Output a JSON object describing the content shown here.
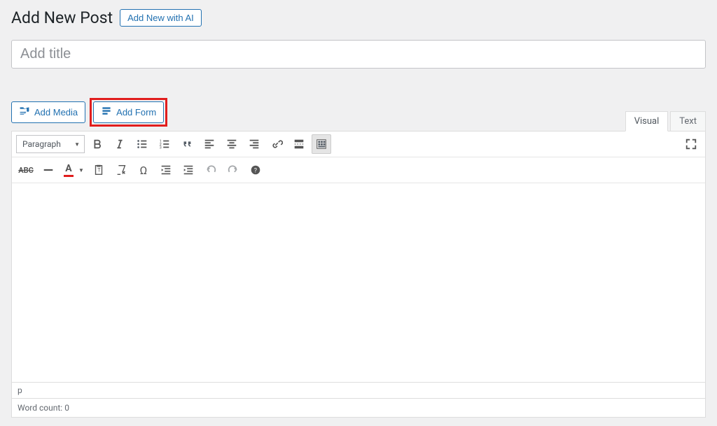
{
  "header": {
    "page_title": "Add New Post",
    "ai_button": "Add New with AI"
  },
  "title_field": {
    "placeholder": "Add title",
    "value": ""
  },
  "media_buttons": {
    "add_media": "Add Media",
    "add_form": "Add Form"
  },
  "tabs": {
    "visual": "Visual",
    "text": "Text",
    "active": "visual"
  },
  "format_dropdown": {
    "selected": "Paragraph"
  },
  "toolbar_row1": [
    {
      "name": "bold-icon"
    },
    {
      "name": "italic-icon"
    },
    {
      "name": "bullet-list-icon"
    },
    {
      "name": "numbered-list-icon"
    },
    {
      "name": "blockquote-icon"
    },
    {
      "name": "align-left-icon"
    },
    {
      "name": "align-center-icon"
    },
    {
      "name": "align-right-icon"
    },
    {
      "name": "link-icon"
    },
    {
      "name": "read-more-icon"
    },
    {
      "name": "toolbar-toggle-icon",
      "active": true
    }
  ],
  "toolbar_row2": [
    {
      "name": "strikethrough-icon"
    },
    {
      "name": "horizontal-rule-icon"
    },
    {
      "name": "text-color-icon"
    },
    {
      "name": "paste-text-icon"
    },
    {
      "name": "clear-formatting-icon"
    },
    {
      "name": "special-char-icon"
    },
    {
      "name": "outdent-icon"
    },
    {
      "name": "indent-icon"
    },
    {
      "name": "undo-icon",
      "dim": true
    },
    {
      "name": "redo-icon",
      "dim": true
    },
    {
      "name": "help-icon"
    }
  ],
  "path": "p",
  "word_count_label": "Word count:",
  "word_count_value": "0",
  "colors": {
    "accent": "#2271b1",
    "highlight_border": "#e11d1d"
  }
}
